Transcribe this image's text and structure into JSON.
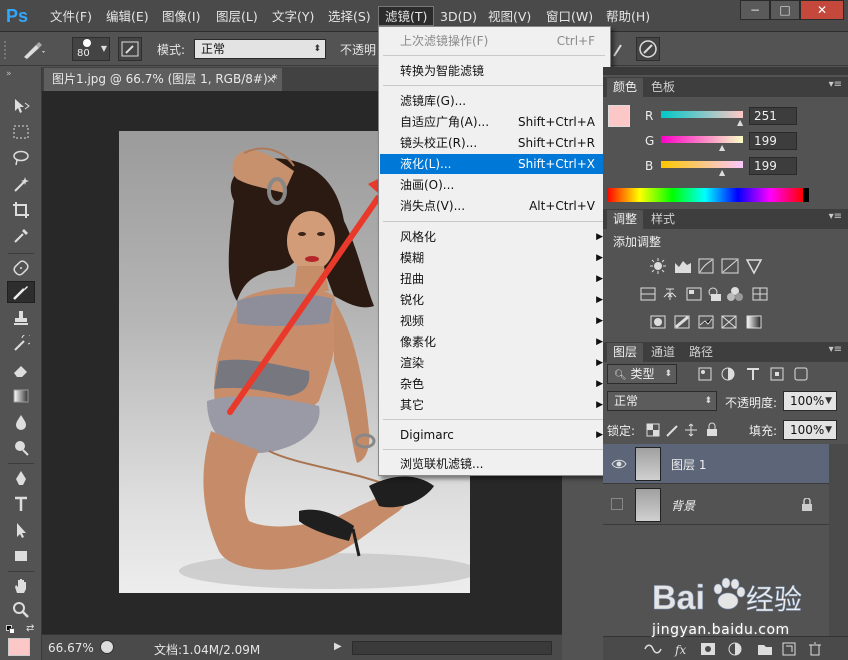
{
  "app": {
    "logo": "Ps"
  },
  "menubar": {
    "items": [
      "文件(F)",
      "编辑(E)",
      "图像(I)",
      "图层(L)",
      "文字(Y)",
      "选择(S)",
      "滤镜(T)",
      "3D(D)",
      "视图(V)",
      "窗口(W)",
      "帮助(H)"
    ],
    "active": "滤镜(T)",
    "window_buttons": [
      "−",
      "□",
      "✕"
    ]
  },
  "options": {
    "brush_size": "80",
    "mode_label": "模式:",
    "mode_value": "正常",
    "opacity_label": "不透明"
  },
  "document": {
    "tab_title": "图片1.jpg @ 66.7% (图层 1, RGB/8#) *",
    "tab_close": "×",
    "zoom": "66.67%",
    "doc_info": "文档:1.04M/2.09M"
  },
  "filter_menu": {
    "last_filter": {
      "label": "上次滤镜操作(F)",
      "shortcut": "Ctrl+F"
    },
    "smart": "转换为智能滤镜",
    "group1": [
      {
        "label": "滤镜库(G)...",
        "shortcut": ""
      },
      {
        "label": "自适应广角(A)...",
        "shortcut": "Shift+Ctrl+A"
      },
      {
        "label": "镜头校正(R)...",
        "shortcut": "Shift+Ctrl+R"
      },
      {
        "label": "液化(L)...",
        "shortcut": "Shift+Ctrl+X"
      },
      {
        "label": "油画(O)...",
        "shortcut": ""
      },
      {
        "label": "消失点(V)...",
        "shortcut": "Alt+Ctrl+V"
      }
    ],
    "submenus": [
      "风格化",
      "模糊",
      "扭曲",
      "锐化",
      "视频",
      "像素化",
      "渲染",
      "杂色",
      "其它"
    ],
    "digimarc": "Digimarc",
    "browse": "浏览联机滤镜..."
  },
  "color_panel": {
    "tabs": [
      "颜色",
      "色板"
    ],
    "channels": [
      {
        "label": "R",
        "value": "251"
      },
      {
        "label": "G",
        "value": "199"
      },
      {
        "label": "B",
        "value": "199"
      }
    ],
    "foreground": "#fbc7c7"
  },
  "adjust_panel": {
    "tabs": [
      "调整",
      "样式"
    ],
    "heading": "添加调整"
  },
  "layers_panel": {
    "tabs": [
      "图层",
      "通道",
      "路径"
    ],
    "filter_type": "类型",
    "blend_mode": "正常",
    "opacity_label": "不透明度:",
    "opacity_value": "100%",
    "lock_label": "锁定:",
    "fill_label": "填充:",
    "fill_value": "100%",
    "layers": [
      {
        "name": "图层 1",
        "selected": true,
        "visible": true
      },
      {
        "name": "背景",
        "selected": false,
        "visible": false
      }
    ]
  },
  "watermark": {
    "brand": "Bai",
    "brand_suffix": "经验",
    "url": "jingyan.baidu.com"
  },
  "colors": {
    "accent": "#0078d7",
    "highlight_arrow": "#e8392b"
  }
}
